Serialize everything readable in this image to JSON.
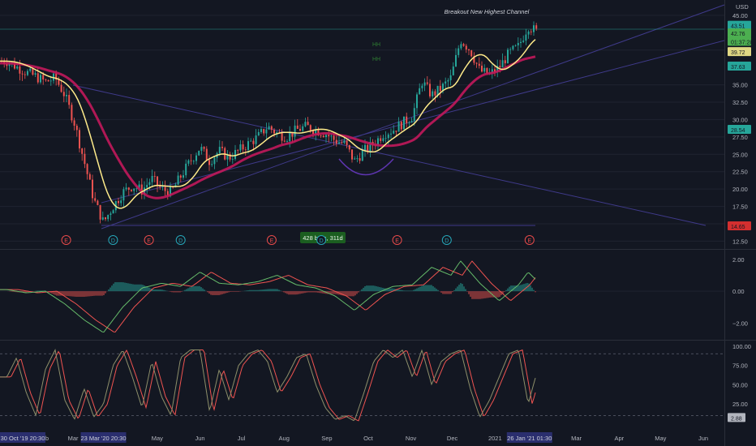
{
  "chart_data": [
    {
      "type": "candlestick",
      "panel": "price",
      "currency": "USD",
      "title": "Breakout New Highest Channel",
      "y_ticks": [
        "45.00",
        "40.00",
        "35.00",
        "32.50",
        "30.00",
        "27.50",
        "25.00",
        "22.50",
        "20.00",
        "17.50",
        "15.00",
        "12.50"
      ],
      "y_ticks_values": [
        45,
        40,
        35,
        32.5,
        30,
        27.5,
        25,
        22.5,
        20,
        17.5,
        15,
        12.5
      ],
      "ylim": [
        11.5,
        46.5
      ],
      "price_labels": [
        {
          "text": "43.51",
          "value": 43.51,
          "color": "#26a69a"
        },
        {
          "text": "42.76",
          "value": 42.4,
          "color": "#4caf50"
        },
        {
          "text": "01:37:28",
          "value": 41.2,
          "color": "#4caf50"
        },
        {
          "text": "39.72",
          "value": 39.72,
          "color": "#e0d884"
        },
        {
          "text": "37.63",
          "value": 37.63,
          "color": "#26a69a"
        },
        {
          "text": "28.54",
          "value": 28.54,
          "color": "#26a69a"
        },
        {
          "text": "14.65",
          "value": 14.65,
          "color": "#d32f2f"
        }
      ],
      "annotations": [
        "HH",
        "HH",
        "428 bars, 311d"
      ],
      "event_markers": [
        {
          "label": "E",
          "date": "2020-02-25",
          "color": "#e84a4a"
        },
        {
          "label": "D",
          "date": "2020-03-30",
          "color": "#26a6b8"
        },
        {
          "label": "E",
          "date": "2020-04-25",
          "color": "#e84a4a"
        },
        {
          "label": "D",
          "date": "2020-05-18",
          "color": "#26a6b8"
        },
        {
          "label": "E",
          "date": "2020-07-23",
          "color": "#e84a4a"
        },
        {
          "label": "D",
          "date": "2020-08-28",
          "color": "#26a6b8"
        },
        {
          "label": "E",
          "date": "2020-10-22",
          "color": "#e84a4a"
        },
        {
          "label": "D",
          "date": "2020-11-27",
          "color": "#26a6b8"
        },
        {
          "label": "E",
          "date": "2021-01-26",
          "color": "#e84a4a"
        }
      ],
      "series_fast_ma": {
        "color": "#ffeb8a"
      },
      "series_slow_ma": {
        "color": "#c2185b"
      },
      "close_points": [
        [
          "2020-01-13",
          38.4
        ],
        [
          "2020-01-20",
          37.6
        ],
        [
          "2020-01-27",
          36.8
        ],
        [
          "2020-02-03",
          36.2
        ],
        [
          "2020-02-10",
          35.4
        ],
        [
          "2020-02-17",
          36.0
        ],
        [
          "2020-02-24",
          33.5
        ],
        [
          "2020-03-02",
          29.5
        ],
        [
          "2020-03-09",
          24.0
        ],
        [
          "2020-03-16",
          18.5
        ],
        [
          "2020-03-23",
          15.2
        ],
        [
          "2020-03-30",
          17.5
        ],
        [
          "2020-04-06",
          19.5
        ],
        [
          "2020-04-13",
          20.5
        ],
        [
          "2020-04-20",
          19.8
        ],
        [
          "2020-04-27",
          21.5
        ],
        [
          "2020-05-04",
          20.0
        ],
        [
          "2020-05-11",
          19.5
        ],
        [
          "2020-05-18",
          21.8
        ],
        [
          "2020-05-25",
          24.0
        ],
        [
          "2020-06-01",
          26.0
        ],
        [
          "2020-06-08",
          24.0
        ],
        [
          "2020-06-15",
          25.5
        ],
        [
          "2020-06-22",
          24.5
        ],
        [
          "2020-06-29",
          25.5
        ],
        [
          "2020-07-06",
          26.5
        ],
        [
          "2020-07-13",
          27.5
        ],
        [
          "2020-07-20",
          29.0
        ],
        [
          "2020-07-27",
          28.0
        ],
        [
          "2020-08-03",
          27.5
        ],
        [
          "2020-08-10",
          28.5
        ],
        [
          "2020-08-17",
          29.0
        ],
        [
          "2020-08-24",
          28.5
        ],
        [
          "2020-08-31",
          28.0
        ],
        [
          "2020-09-07",
          27.0
        ],
        [
          "2020-09-14",
          26.5
        ],
        [
          "2020-09-21",
          24.0
        ],
        [
          "2020-09-28",
          25.5
        ],
        [
          "2020-10-05",
          26.5
        ],
        [
          "2020-10-12",
          28.0
        ],
        [
          "2020-10-19",
          28.5
        ],
        [
          "2020-10-26",
          29.5
        ],
        [
          "2020-11-02",
          30.5
        ],
        [
          "2020-11-09",
          35.5
        ],
        [
          "2020-11-16",
          33.5
        ],
        [
          "2020-11-23",
          34.5
        ],
        [
          "2020-11-30",
          36.0
        ],
        [
          "2020-12-07",
          41.5
        ],
        [
          "2020-12-14",
          40.0
        ],
        [
          "2020-12-21",
          37.0
        ],
        [
          "2020-12-28",
          36.5
        ],
        [
          "2021-01-04",
          37.5
        ],
        [
          "2021-01-11",
          39.5
        ],
        [
          "2021-01-18",
          40.5
        ],
        [
          "2021-01-25",
          43.5
        ],
        [
          "2021-02-01",
          42.5
        ]
      ]
    },
    {
      "type": "histogram",
      "panel": "oscillator",
      "y_ticks": [
        "2.00",
        "0.00",
        "−2.00"
      ],
      "y_ticks_values": [
        2,
        0,
        -2
      ],
      "ylim": [
        -3.0,
        2.5
      ],
      "values": [
        [
          "2020-01-13",
          0.1
        ],
        [
          "2020-01-27",
          -0.1
        ],
        [
          "2020-02-10",
          0.0
        ],
        [
          "2020-02-24",
          -0.8
        ],
        [
          "2020-03-09",
          -1.8
        ],
        [
          "2020-03-23",
          -2.6
        ],
        [
          "2020-04-06",
          -1.0
        ],
        [
          "2020-04-20",
          0.2
        ],
        [
          "2020-05-04",
          0.5
        ],
        [
          "2020-05-18",
          0.3
        ],
        [
          "2020-06-01",
          1.2
        ],
        [
          "2020-06-15",
          0.5
        ],
        [
          "2020-06-29",
          0.4
        ],
        [
          "2020-07-13",
          0.6
        ],
        [
          "2020-07-27",
          1.0
        ],
        [
          "2020-08-10",
          0.4
        ],
        [
          "2020-08-24",
          0.2
        ],
        [
          "2020-09-07",
          -0.3
        ],
        [
          "2020-09-21",
          -1.2
        ],
        [
          "2020-10-05",
          -0.2
        ],
        [
          "2020-10-19",
          0.3
        ],
        [
          "2020-11-02",
          0.4
        ],
        [
          "2020-11-16",
          1.5
        ],
        [
          "2020-11-30",
          1.0
        ],
        [
          "2020-12-07",
          1.9
        ],
        [
          "2020-12-21",
          0.5
        ],
        [
          "2021-01-04",
          -0.6
        ],
        [
          "2021-01-18",
          0.4
        ],
        [
          "2021-01-25",
          1.2
        ],
        [
          "2021-02-01",
          0.6
        ]
      ]
    },
    {
      "type": "line",
      "panel": "stochastic",
      "y_ticks": [
        "100.00",
        "75.00",
        "50.00",
        "25.00"
      ],
      "y_ticks_values": [
        100,
        75,
        50,
        25
      ],
      "ylim": [
        0,
        105
      ],
      "last_value_label": "2.88",
      "bands": [
        90,
        10
      ],
      "values": [
        [
          "2020-01-13",
          60
        ],
        [
          "2020-01-20",
          85
        ],
        [
          "2020-01-27",
          40
        ],
        [
          "2020-02-03",
          10
        ],
        [
          "2020-02-10",
          70
        ],
        [
          "2020-02-17",
          95
        ],
        [
          "2020-02-24",
          30
        ],
        [
          "2020-03-02",
          5
        ],
        [
          "2020-03-09",
          45
        ],
        [
          "2020-03-16",
          8
        ],
        [
          "2020-03-23",
          25
        ],
        [
          "2020-03-30",
          75
        ],
        [
          "2020-04-06",
          95
        ],
        [
          "2020-04-13",
          60
        ],
        [
          "2020-04-20",
          20
        ],
        [
          "2020-04-27",
          80
        ],
        [
          "2020-05-04",
          35
        ],
        [
          "2020-05-11",
          10
        ],
        [
          "2020-05-18",
          85
        ],
        [
          "2020-05-25",
          95
        ],
        [
          "2020-06-01",
          95
        ],
        [
          "2020-06-08",
          15
        ],
        [
          "2020-06-15",
          70
        ],
        [
          "2020-06-22",
          30
        ],
        [
          "2020-06-29",
          75
        ],
        [
          "2020-07-06",
          90
        ],
        [
          "2020-07-13",
          95
        ],
        [
          "2020-07-20",
          80
        ],
        [
          "2020-07-27",
          40
        ],
        [
          "2020-08-03",
          60
        ],
        [
          "2020-08-10",
          85
        ],
        [
          "2020-08-17",
          90
        ],
        [
          "2020-08-24",
          50
        ],
        [
          "2020-08-31",
          20
        ],
        [
          "2020-09-07",
          5
        ],
        [
          "2020-09-14",
          10
        ],
        [
          "2020-09-21",
          3
        ],
        [
          "2020-09-28",
          40
        ],
        [
          "2020-10-05",
          80
        ],
        [
          "2020-10-12",
          95
        ],
        [
          "2020-10-19",
          85
        ],
        [
          "2020-10-26",
          95
        ],
        [
          "2020-11-02",
          60
        ],
        [
          "2020-11-09",
          95
        ],
        [
          "2020-11-16",
          50
        ],
        [
          "2020-11-23",
          80
        ],
        [
          "2020-11-30",
          90
        ],
        [
          "2020-12-07",
          95
        ],
        [
          "2020-12-14",
          45
        ],
        [
          "2020-12-21",
          8
        ],
        [
          "2020-12-28",
          30
        ],
        [
          "2021-01-04",
          60
        ],
        [
          "2021-01-11",
          90
        ],
        [
          "2021-01-18",
          95
        ],
        [
          "2021-01-25",
          25
        ],
        [
          "2021-02-01",
          70
        ]
      ]
    }
  ],
  "time_axis": {
    "ticks": [
      {
        "text": "Mar",
        "date": "2020-03-01"
      },
      {
        "text": "May",
        "date": "2020-05-01"
      },
      {
        "text": "Jun",
        "date": "2020-06-01"
      },
      {
        "text": "Jul",
        "date": "2020-07-01"
      },
      {
        "text": "Aug",
        "date": "2020-08-01"
      },
      {
        "text": "Sep",
        "date": "2020-09-01"
      },
      {
        "text": "Oct",
        "date": "2020-10-01"
      },
      {
        "text": "Nov",
        "date": "2020-11-01"
      },
      {
        "text": "Dec",
        "date": "2020-12-01"
      },
      {
        "text": "2021",
        "date": "2021-01-01"
      },
      {
        "text": "Mar",
        "date": "2021-03-01"
      },
      {
        "text": "Apr",
        "date": "2021-04-01"
      },
      {
        "text": "May",
        "date": "2021-05-01"
      },
      {
        "text": "Jun",
        "date": "2021-06-01"
      }
    ],
    "range_labels": [
      {
        "text": "30 Oct '19  20:30",
        "date": "2020-01-08",
        "color": "#2a2e6e"
      },
      {
        "text": "23 Mar '20  20:30",
        "date": "2020-03-23",
        "color": "#2a2e6e"
      },
      {
        "text": "26 Jan '21  01:30",
        "date": "2021-01-26",
        "color": "#2a2e6e"
      }
    ],
    "partial_label": "b"
  },
  "colors": {
    "background": "#131722",
    "up": "#26a69a",
    "down": "#ef5350",
    "grid": "#1f2330",
    "axis_text": "#b2b5be",
    "channel": "#3f3a8a",
    "cloud_up": "#1b5e20",
    "cloud_down": "#6a1b2a"
  }
}
